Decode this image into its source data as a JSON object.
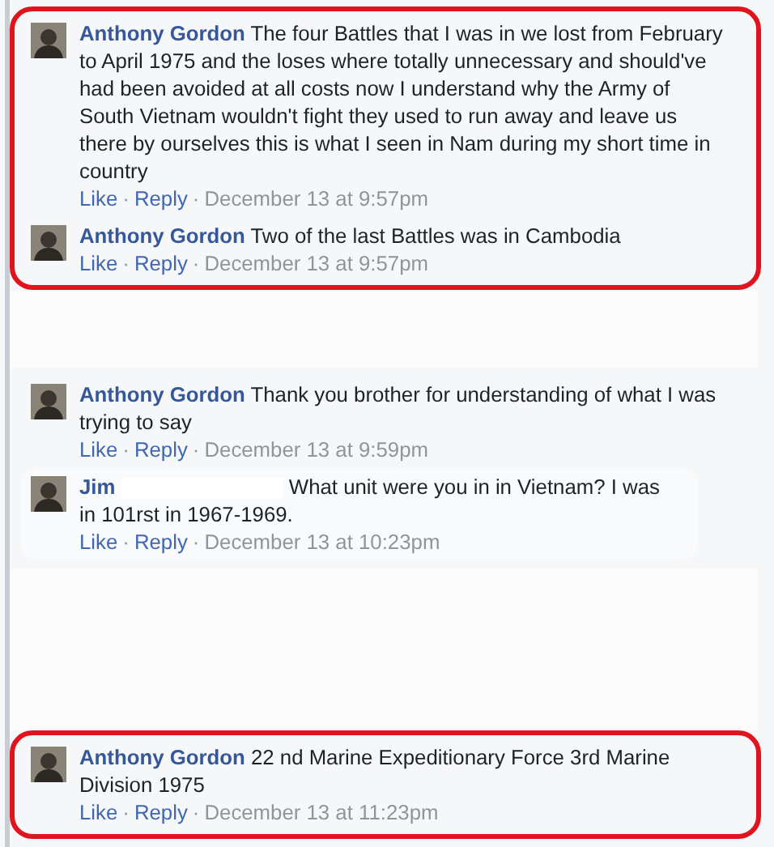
{
  "groups": [
    {
      "highlighted": true,
      "comments": [
        {
          "author": "Anthony Gordon",
          "text": "The four Battles that I was in we lost from February to April 1975 and the loses where totally unnecessary and should've had been avoided at all costs now I understand why the Army of South Vietnam wouldn't fight they used to run away and leave us there by ourselves this is what I seen in Nam during my short time in country",
          "redacted": false,
          "actions": [
            {
              "kind": "like",
              "text": "Like"
            },
            {
              "kind": "separator",
              "text": "·"
            },
            {
              "kind": "reply",
              "text": "Reply"
            },
            {
              "kind": "separator",
              "text": "·"
            }
          ],
          "time": "December 13 at 9:57pm"
        },
        {
          "author": "Anthony Gordon",
          "text": "Two of the last Battles was in Cambodia",
          "redacted": false,
          "actions": [
            {
              "kind": "like",
              "text": "Like"
            },
            {
              "kind": "separator",
              "text": "·"
            },
            {
              "kind": "reply",
              "text": "Reply"
            },
            {
              "kind": "separator",
              "text": "·"
            }
          ],
          "time": "December 13 at 9:57pm"
        }
      ]
    },
    {
      "highlighted": false,
      "comments": [
        {
          "author": "Anthony Gordon",
          "text": "Thank you brother for understanding of what I was trying to say",
          "redacted": false,
          "actions": [
            {
              "kind": "like",
              "text": "Like"
            },
            {
              "kind": "separator",
              "text": "·"
            },
            {
              "kind": "reply",
              "text": "Reply"
            },
            {
              "kind": "separator",
              "text": "·"
            }
          ],
          "time": "December 13 at 9:59pm"
        },
        {
          "author": "Jim",
          "text": "What unit were you in in Vietnam? I was in 101rst in 1967-1969.",
          "redacted": true,
          "actions": [
            {
              "kind": "like",
              "text": "Like"
            },
            {
              "kind": "separator",
              "text": "·"
            },
            {
              "kind": "reply",
              "text": "Reply"
            },
            {
              "kind": "separator",
              "text": "·"
            }
          ],
          "time": "December 13 at 10:23pm"
        }
      ]
    },
    {
      "highlighted": true,
      "comments": [
        {
          "author": "Anthony Gordon",
          "text": "22 nd Marine Expeditionary Force 3rd Marine Division 1975",
          "redacted": false,
          "actions": [
            {
              "kind": "like",
              "text": "Like"
            },
            {
              "kind": "separator",
              "text": "·"
            },
            {
              "kind": "reply",
              "text": "Reply"
            },
            {
              "kind": "separator",
              "text": "·"
            }
          ],
          "time": "December 13 at 11:23pm"
        }
      ]
    }
  ]
}
